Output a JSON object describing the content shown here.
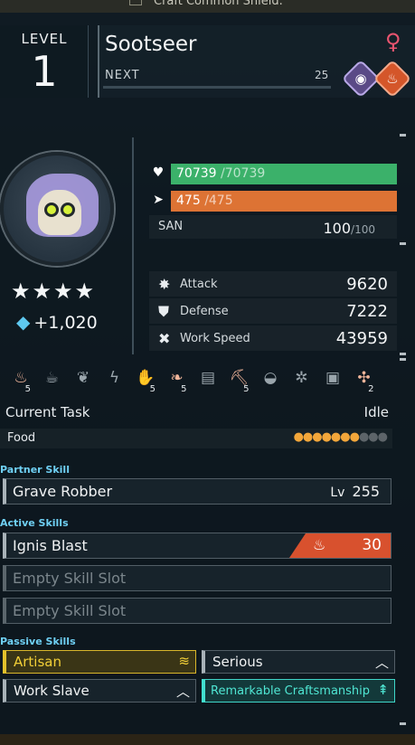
{
  "top_strip": {
    "text": "Craft Common Shield."
  },
  "level": {
    "label": "LEVEL",
    "value": "1"
  },
  "pal": {
    "name": "Sootseer",
    "gender_icon": "female-icon",
    "next_label": "NEXT",
    "next_value": "25",
    "elements": [
      "dark-element-icon",
      "fire-element-icon"
    ]
  },
  "stats": {
    "hp": {
      "current": "70739",
      "max": "/70739"
    },
    "sp": {
      "current": "475",
      "max": "/475"
    },
    "san": {
      "label": "SAN",
      "value": "100",
      "max": "/100"
    },
    "attack": {
      "label": "Attack",
      "value": "9620"
    },
    "defense": {
      "label": "Defense",
      "value": "7222"
    },
    "work_speed": {
      "label": "Work Speed",
      "value": "43959"
    }
  },
  "rank_stars": "★★★★",
  "souls": "+1,020",
  "work_suitability": [
    {
      "icon": "kindling-icon",
      "glyph": "♨",
      "level": "5",
      "on": true
    },
    {
      "icon": "watering-icon",
      "glyph": "☕",
      "level": "",
      "on": false
    },
    {
      "icon": "planting-icon",
      "glyph": "❦",
      "level": "",
      "on": false
    },
    {
      "icon": "electricity-icon",
      "glyph": "ϟ",
      "level": "",
      "on": false
    },
    {
      "icon": "handiwork-icon",
      "glyph": "✋",
      "level": "5",
      "on": true
    },
    {
      "icon": "gathering-icon",
      "glyph": "❧",
      "level": "5",
      "on": true
    },
    {
      "icon": "lumbering-icon",
      "glyph": "▤",
      "level": "",
      "on": false
    },
    {
      "icon": "mining-icon",
      "glyph": "⛏",
      "level": "5",
      "on": true
    },
    {
      "icon": "medicine-icon",
      "glyph": "◒",
      "level": "",
      "on": false
    },
    {
      "icon": "cooling-icon",
      "glyph": "✲",
      "level": "",
      "on": false
    },
    {
      "icon": "transporting-icon",
      "glyph": "▣",
      "level": "",
      "on": false
    },
    {
      "icon": "farming-icon",
      "glyph": "✣",
      "level": "2",
      "on": true
    }
  ],
  "current_task": {
    "label": "Current Task",
    "value": "Idle"
  },
  "food": {
    "label": "Food",
    "full_pips": "●●●●●●●",
    "empty_pips": "●●●"
  },
  "sections": {
    "partner": "Partner Skill",
    "active": "Active Skills",
    "passive": "Passive Skills"
  },
  "partner_skill": {
    "name": "Grave Robber",
    "lv_label": "Lv",
    "lv_value": "255"
  },
  "active_skills": [
    {
      "name": "Ignis Blast",
      "power": "30",
      "element_icon": "fire-element-icon"
    },
    {
      "name": "Empty Skill Slot"
    },
    {
      "name": "Empty Skill Slot"
    }
  ],
  "passive_skills": [
    {
      "name": "Artisan",
      "rank_icon": "rank-3-up-icon"
    },
    {
      "name": "Serious",
      "rank_icon": "rank-1-up-icon"
    },
    {
      "name": "Work Slave",
      "rank_icon": "rank-1-up-icon"
    },
    {
      "name": "Remarkable Craftsmanship",
      "rank_icon": "rank-4-up-icon"
    }
  ],
  "colors": {
    "hp_bar": "#3bb16a",
    "sp_bar": "#dd7334",
    "section_label": "#6fd0f4",
    "fire": "#d8512e",
    "gold_passive": "#e3c12b",
    "rainbow_passive": "#42e0cf"
  }
}
